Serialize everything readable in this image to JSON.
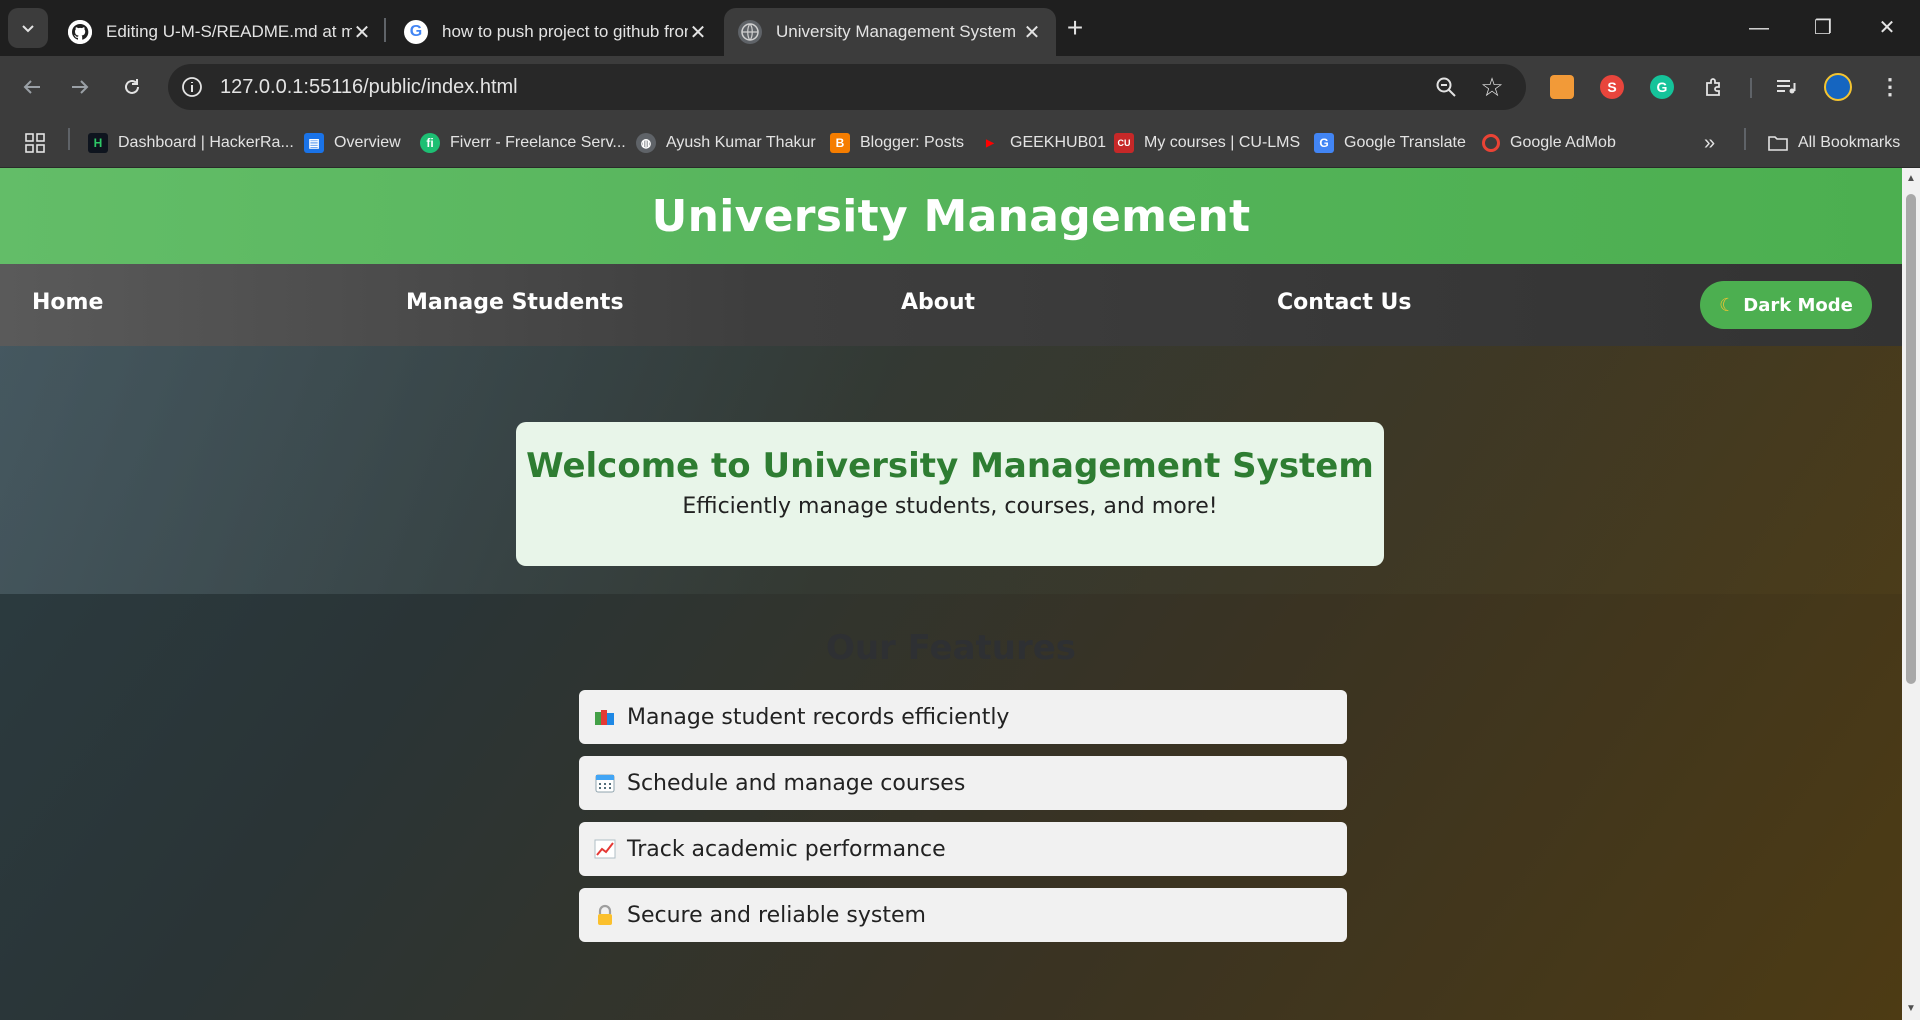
{
  "browser": {
    "tabs": [
      {
        "title": "Editing U-M-S/README.md at main",
        "icon": "github-icon"
      },
      {
        "title": "how to push project to github from vs code",
        "icon": "google-icon"
      },
      {
        "title": "University Management System",
        "icon": "globe-icon"
      }
    ],
    "url": "127.0.0.1:55116/public/index.html",
    "bookmarks": [
      {
        "label": "Dashboard | HackerRa...",
        "icon": "hackerrank-icon"
      },
      {
        "label": "Overview",
        "icon": "store-icon"
      },
      {
        "label": "Fiverr - Freelance Serv...",
        "icon": "fiverr-icon"
      },
      {
        "label": "Ayush Kumar Thakur",
        "icon": "globe-icon"
      },
      {
        "label": "Blogger: Posts",
        "icon": "blogger-icon"
      },
      {
        "label": "GEEKHUB01",
        "icon": "youtube-icon"
      },
      {
        "label": "My courses | CU-LMS",
        "icon": "cu-icon"
      },
      {
        "label": "Google Translate",
        "icon": "translate-icon"
      },
      {
        "label": "Google AdMob",
        "icon": "admob-icon"
      }
    ],
    "all_bookmarks": "All Bookmarks"
  },
  "site": {
    "title": "University Management",
    "nav": [
      "Home",
      "Manage Students",
      "About",
      "Contact Us"
    ],
    "dark_mode": "Dark Mode",
    "welcome_title": "Welcome to University Management System",
    "welcome_text": "Efficiently manage students, courses, and more!",
    "features_title": "Our Features",
    "features": [
      {
        "text": "Manage student records efficiently",
        "icon": "books-icon"
      },
      {
        "text": "Schedule and manage courses",
        "icon": "calendar-icon"
      },
      {
        "text": "Track academic performance",
        "icon": "chart-icon"
      },
      {
        "text": "Secure and reliable system",
        "icon": "lock-icon"
      }
    ]
  },
  "colors": {
    "header_green": "#4caf50",
    "welcome_title": "#2e7d32",
    "welcome_bg": "#e8f5e9"
  }
}
